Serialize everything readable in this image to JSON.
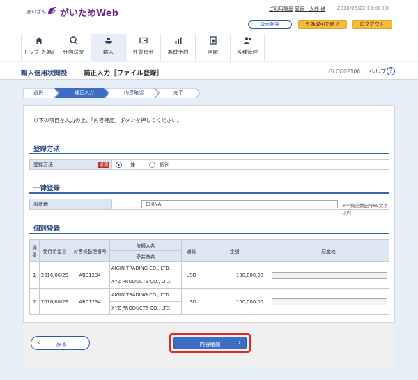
{
  "header": {
    "brand_small": "あいざん",
    "brand_main": "がいためWeb",
    "links": {
      "history": "ご利用履歴",
      "user": "愛銀　太郎 様",
      "datetime": "2016/06/22 10:00:00"
    },
    "buttons": {
      "rates": "公示相場",
      "end_fx": "外為取引を終了",
      "logout": "ログアウト"
    }
  },
  "nav": {
    "items": [
      {
        "label": "トップ(外為)",
        "icon": "home-icon"
      },
      {
        "label": "仕向送金",
        "icon": "remittance-icon"
      },
      {
        "label": "輸入",
        "icon": "ship-icon"
      },
      {
        "label": "外貨預金",
        "icon": "deposit-icon"
      },
      {
        "label": "為替予約",
        "icon": "chart-icon"
      },
      {
        "label": "承認",
        "icon": "approval-icon"
      },
      {
        "label": "各種管理",
        "icon": "user-admin-icon"
      }
    ]
  },
  "title": {
    "category": "輸入信用状開設",
    "page": "補正入力［ファイル登録］",
    "code": "GLCO02106",
    "help": "ヘルプ",
    "help_icon": "?"
  },
  "steps": [
    "選択",
    "補正入力",
    "内容確認",
    "完了"
  ],
  "instruction": "以下の項目を入力の上、「内容確認」ボタンを押してください。",
  "sections": {
    "method": {
      "title": "登録方法",
      "label": "登録方法",
      "required": "必須",
      "options": [
        "一律",
        "個別"
      ],
      "selected": "一律"
    },
    "bulk": {
      "title": "一律登録",
      "label": "原産地",
      "value": "CHINA",
      "hint": "※半角英数記号65文字以内"
    },
    "individual": {
      "title": "個別登録",
      "headers": {
        "no": "通番",
        "date": "発行希望日",
        "ref": "お客様整理番号",
        "applicant": "依頼人名",
        "beneficiary": "受益者名",
        "currency": "通貨",
        "amount": "金額",
        "origin": "原産地"
      },
      "rows": [
        {
          "no": "1",
          "date": "2016/06/29",
          "ref": "ABC1234",
          "applicant": "AIGIN TRADING CO., LTD.",
          "beneficiary": "XYZ PRODUCTS CO., LTD.",
          "currency": "USD",
          "amount": "100,000.00"
        },
        {
          "no": "2",
          "date": "2016/06/29",
          "ref": "ABC1234",
          "applicant": "AIGIN TRADING CO., LTD.",
          "beneficiary": "XYZ PRODUCTS CO., LTD.",
          "currency": "USD",
          "amount": "100,000.00"
        }
      ]
    }
  },
  "footer": {
    "back": "戻る",
    "confirm": "内容確認"
  },
  "colors": {
    "brand": "#6b2a8a",
    "primary": "#3d6ec4",
    "accent_orange": "#f5b93e",
    "required_red": "#c8312b",
    "highlight_red": "#d92b2b"
  }
}
